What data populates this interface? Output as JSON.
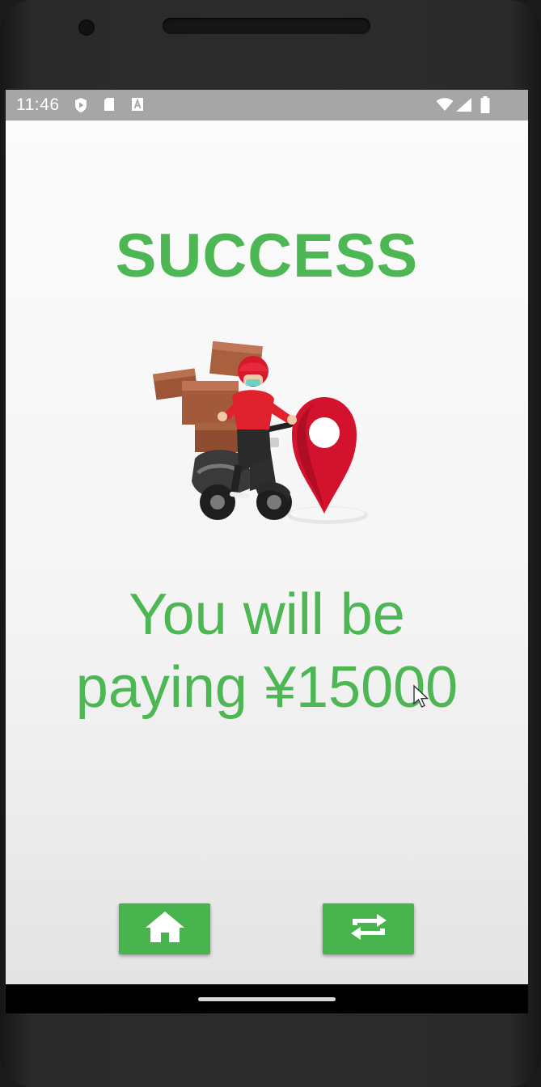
{
  "status_bar": {
    "time": "11:46",
    "icons": [
      "shield-play-icon",
      "sd-card-icon",
      "font-a-icon",
      "wifi-icon",
      "cellular-signal-icon",
      "battery-icon"
    ]
  },
  "app": {
    "title": "SUCCESS",
    "message_line1": "You will be",
    "message_line2": "paying ¥15000",
    "hero_image": "delivery-scooter-with-location-pin",
    "buttons": [
      {
        "icon": "home-icon"
      },
      {
        "icon": "repeat-icon"
      }
    ]
  },
  "colors": {
    "accent": "#4cb753",
    "button": "#47b44e",
    "status_bar": "#a6a6a6",
    "pin_red": "#d3132e",
    "box_brown": "#a0573a"
  }
}
